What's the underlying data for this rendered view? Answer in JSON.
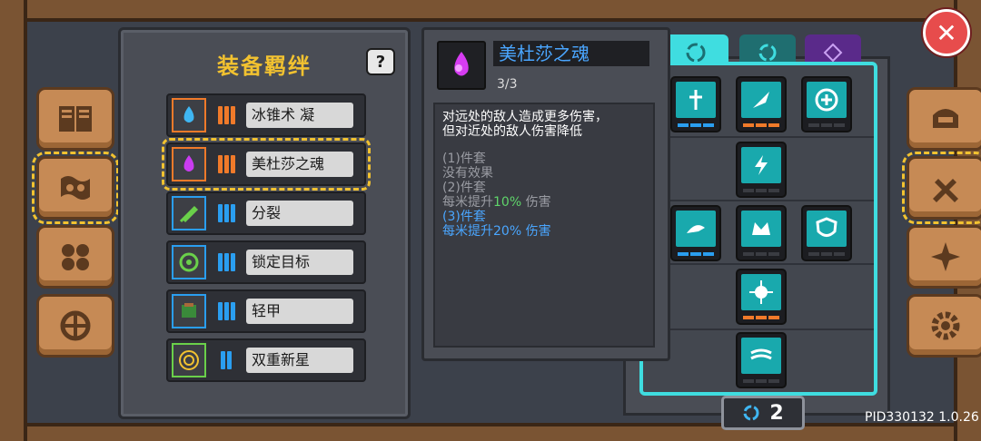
{
  "left_panel": {
    "title": "装备羁绊",
    "help": "?",
    "sets": [
      {
        "label": "冰锥术 凝",
        "icon": "ice-flame-icon",
        "bar_color": "#f07a2a",
        "bars": 3
      },
      {
        "label": "美杜莎之魂",
        "icon": "purple-soul-icon",
        "bar_color": "#f07a2a",
        "bars": 3
      },
      {
        "label": "分裂",
        "icon": "split-arrows-icon",
        "bar_color": "#2a9ef0",
        "bars": 3
      },
      {
        "label": "锁定目标",
        "icon": "target-icon",
        "bar_color": "#2a9ef0",
        "bars": 3
      },
      {
        "label": "轻甲",
        "icon": "light-armor-icon",
        "bar_color": "#2a9ef0",
        "bars": 3
      },
      {
        "label": "双重新星",
        "icon": "double-nova-icon",
        "bar_color": "#2a9ef0",
        "bars": 2
      }
    ]
  },
  "detail": {
    "name": "美杜莎之魂",
    "count": "3/3",
    "desc_line1": "对远处的敌人造成更多伤害，",
    "desc_line2": "但对近处的敌人伤害降低",
    "tier1_title": "(1)件套",
    "tier1_desc": "没有效果",
    "tier2_title": "(2)件套",
    "tier2_prefix": "每米提升",
    "tier2_value": "10%",
    "tier2_suffix": " 伤害",
    "tier3_title": "(3)件套",
    "tier3_desc": "每米提升20% 伤害"
  },
  "skill_counter": "2",
  "footer": {
    "pid": "PID330132 1.0.26"
  },
  "close": "✕",
  "colors": {
    "accent_cyan": "#3fdde0",
    "title_gold": "#f2c230",
    "link_blue": "#4aa6ff"
  }
}
